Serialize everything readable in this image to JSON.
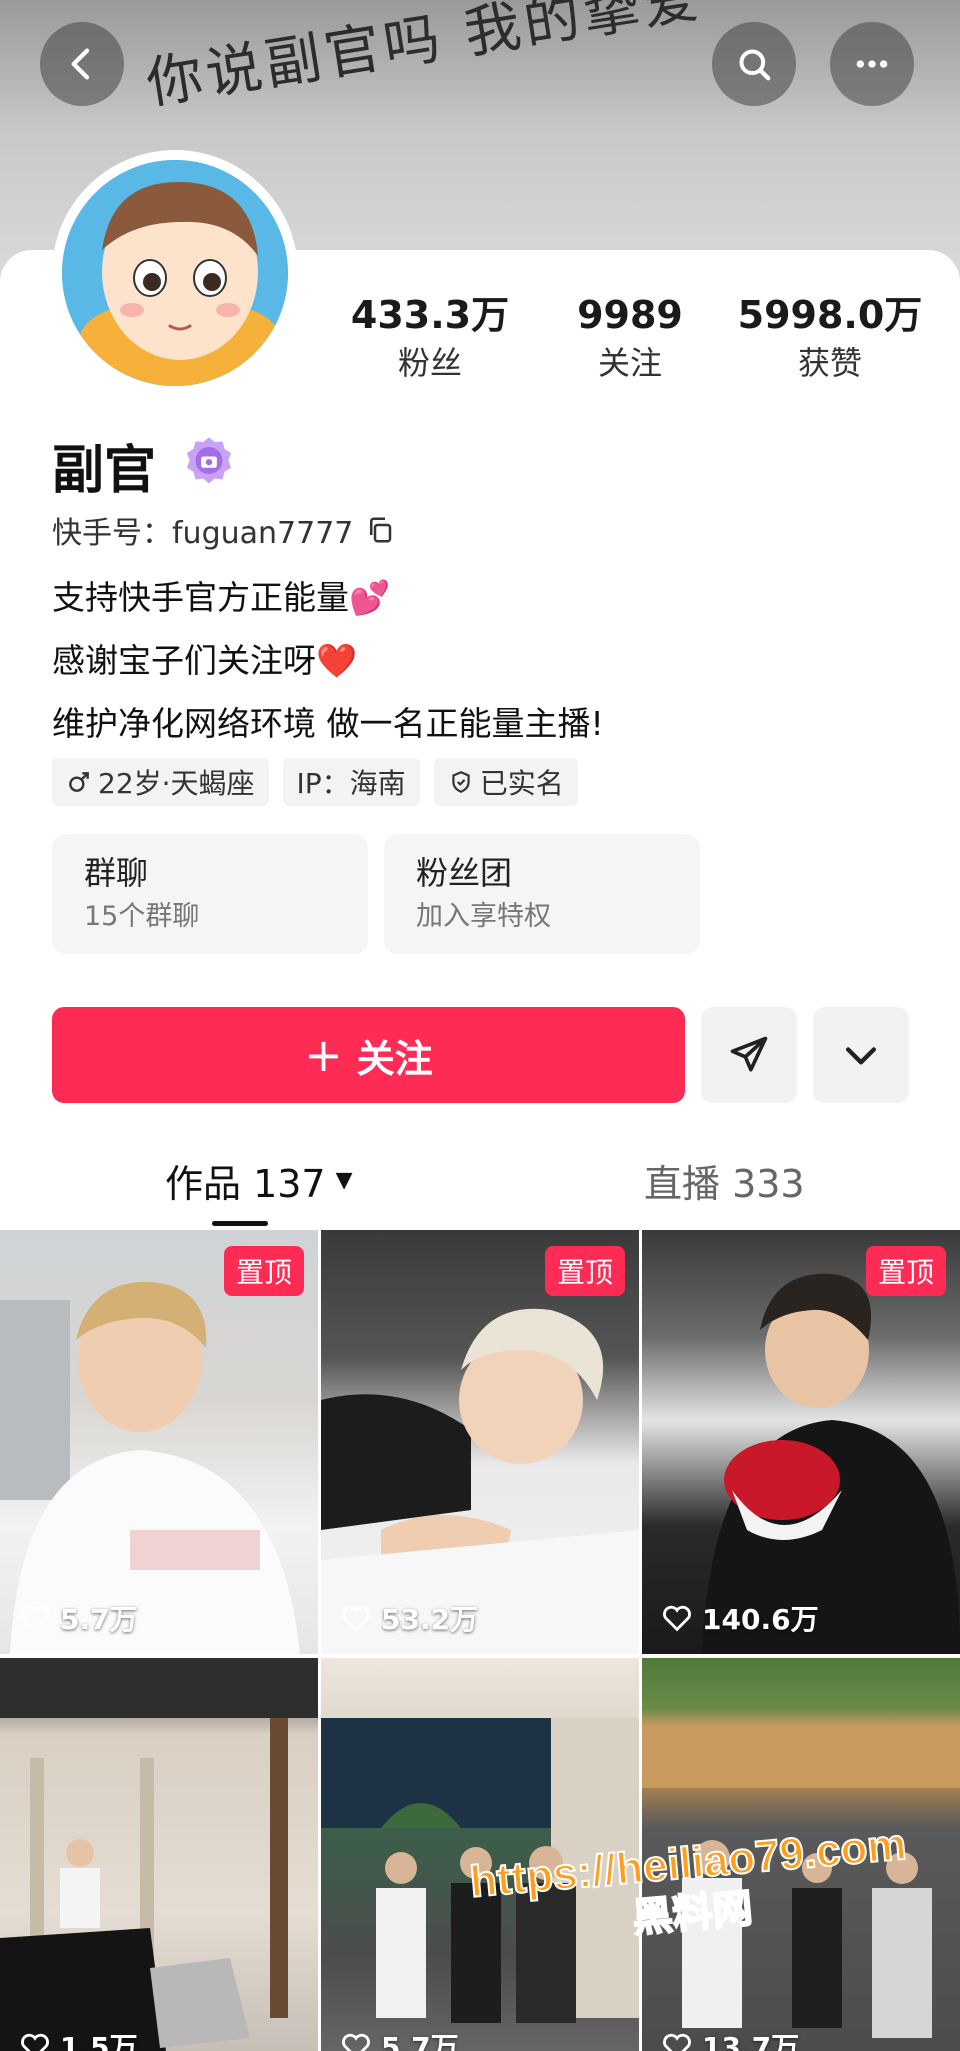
{
  "banner": {
    "text": "你说副官吗 我的挚爱"
  },
  "profile": {
    "name": "副官",
    "kuaishou_id": "快手号：fuguan7777",
    "stats": [
      {
        "value": "433.3万",
        "label": "粉丝"
      },
      {
        "value": "9989",
        "label": "关注"
      },
      {
        "value": "5998.0万",
        "label": "获赞"
      }
    ],
    "bio": [
      "支持快手官方正能量💕",
      "感谢宝子们关注呀❤️",
      "维护净化网络环境 做一名正能量主播!"
    ],
    "tags": {
      "age": "22岁·天蝎座",
      "ip": "IP：海南",
      "verified": "已实名"
    }
  },
  "entries": [
    {
      "title": "群聊",
      "subtitle": "15个群聊"
    },
    {
      "title": "粉丝团",
      "subtitle": "加入享特权"
    }
  ],
  "actions": {
    "follow_plus": "+",
    "follow_label": "关注"
  },
  "tabs": {
    "works": "作品 137",
    "works_caret": "▼",
    "live": "直播 333"
  },
  "videos": [
    {
      "pinned": "置顶",
      "likes": "5.7万"
    },
    {
      "pinned": "置顶",
      "likes": "53.2万"
    },
    {
      "pinned": "置顶",
      "likes": "140.6万"
    },
    {
      "pinned": "",
      "likes": "1.5万"
    },
    {
      "pinned": "",
      "likes": "5.7万"
    },
    {
      "pinned": "",
      "likes": "13.7万"
    }
  ],
  "watermark": {
    "line1": "https://heiliao79.com",
    "line2": "黑料网"
  },
  "colors": {
    "accent": "#fe2c55",
    "badge": "#b27cf0"
  },
  "icons": [
    "back-arrow-icon",
    "search-icon",
    "more-icon",
    "verified-badge-icon",
    "copy-icon",
    "male-icon",
    "shield-check-icon",
    "share-send-icon",
    "chevron-down-icon",
    "heart-icon"
  ]
}
